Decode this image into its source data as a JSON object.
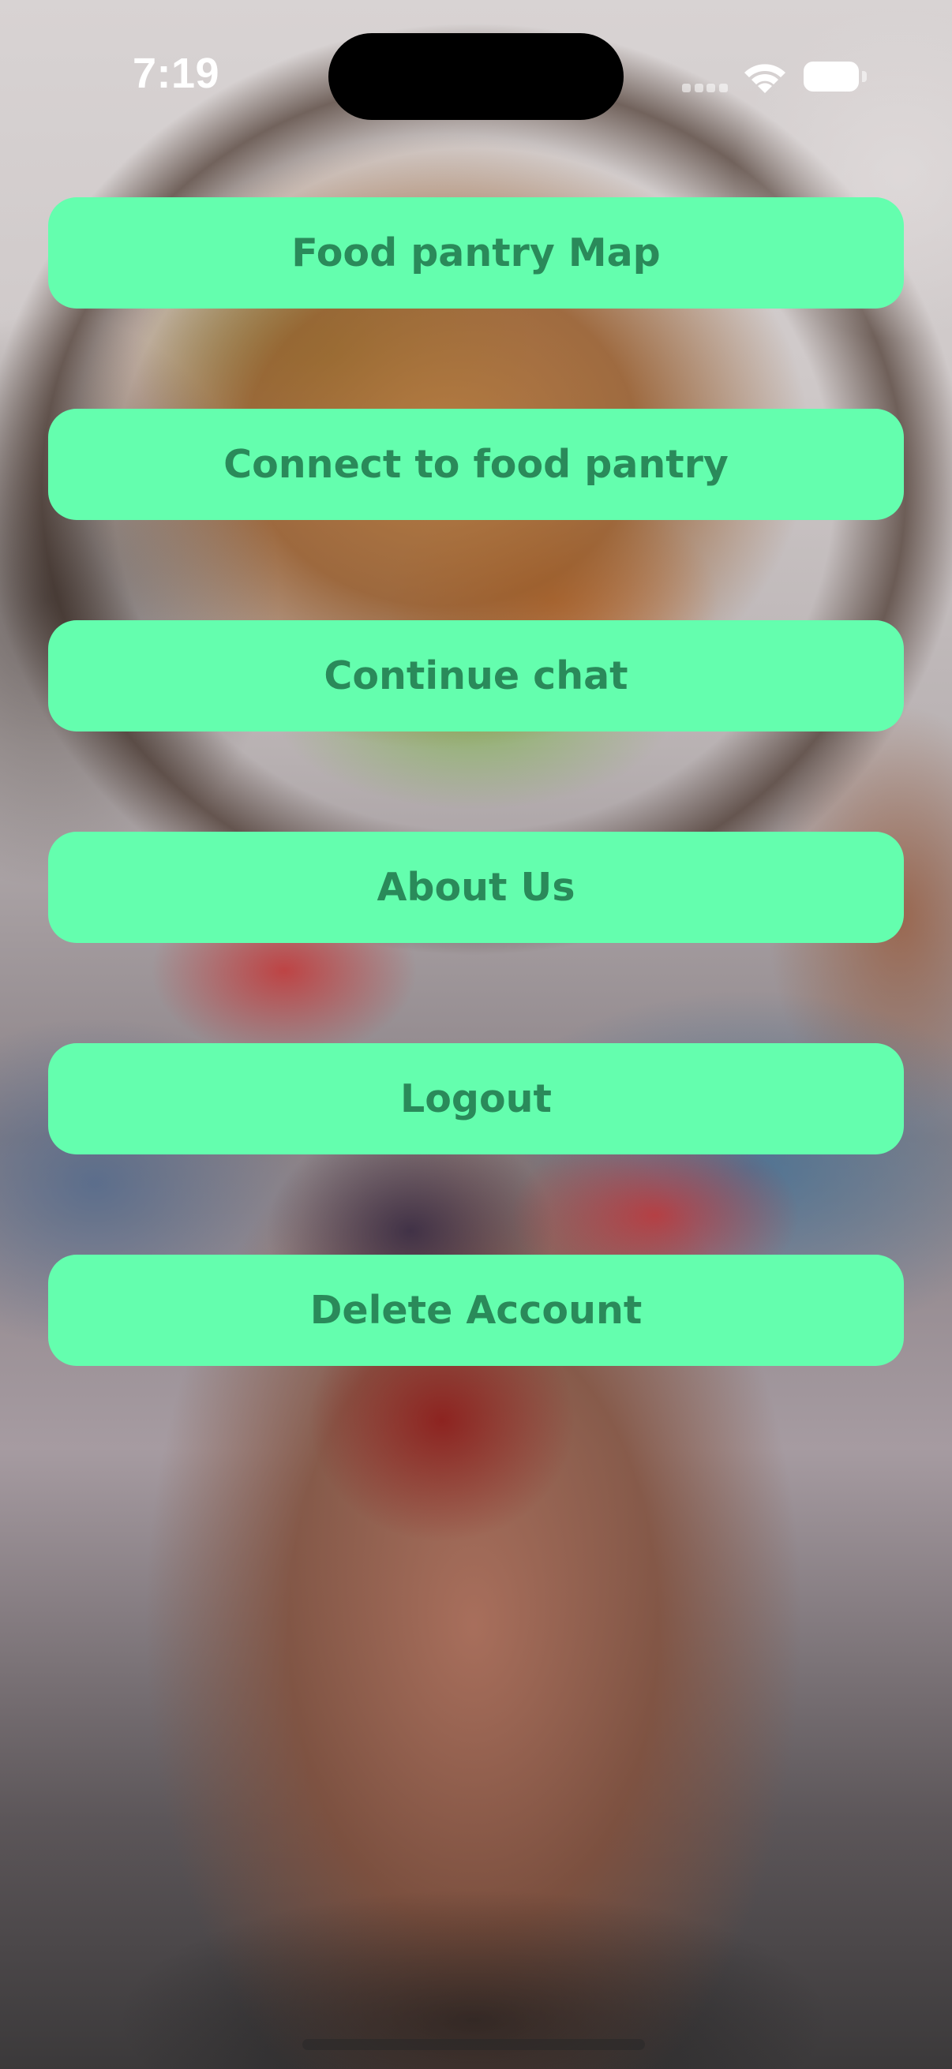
{
  "status_bar": {
    "time": "7:19",
    "icons": [
      "cellular-signal-icon",
      "wifi-icon",
      "battery-icon"
    ]
  },
  "menu": {
    "buttons": [
      {
        "label": "Food pantry Map"
      },
      {
        "label": "Connect to food pantry"
      },
      {
        "label": "Continue chat"
      },
      {
        "label": "About Us"
      },
      {
        "label": "Logout"
      },
      {
        "label": "Delete Account"
      }
    ]
  },
  "colors": {
    "button_background": "#64feae",
    "button_text": "#2a8a5a"
  }
}
